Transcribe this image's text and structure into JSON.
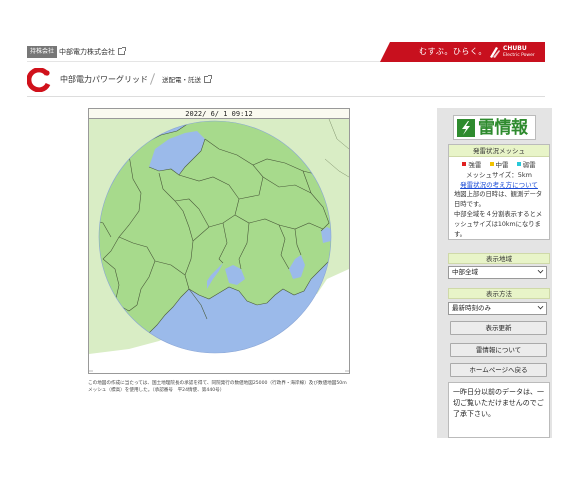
{
  "header": {
    "badge": "持株会社",
    "company": "中部電力株式会社",
    "slogan": "むすぶ。ひらく。",
    "corp_logo_name": "CHUBU",
    "corp_logo_sub": "Electric Power",
    "brand_name": "中部電力パワーグリッド",
    "breadcrumb": "送配電・託送"
  },
  "map": {
    "datetime": "2022/ 6/ 1 09:12",
    "note": "この地図の作成に当たっては、国土地理院長の承認を得て、同院発行の数値地図25000（行政界・海岸線）及び数値地図50mメッシュ（標高）を使用した。（承認番号　平24情使、第440号）",
    "colors": {
      "land": "#cfe8b8",
      "radar": "#98b8ec",
      "radar_land": "#a6d98b",
      "border": "#4a5a3a"
    }
  },
  "panel": {
    "logo_text": "雷情報",
    "status_title": "発雷状況メッシュ",
    "legend": [
      {
        "label": "強雷",
        "color": "#e02020"
      },
      {
        "label": "中雷",
        "color": "#f2c200"
      },
      {
        "label": "弱雷",
        "color": "#28c8d8"
      }
    ],
    "mesh_size": "メッシュサイズ：5km",
    "howto_link": "発雷状況の考え方について",
    "desc1": "地図上部の日時は、観測データ日時です。",
    "desc2": "中部全域を４分割表示するとメッシュサイズは10kmになります。",
    "area_title": "表示地域",
    "area_value": "中部全域",
    "method_title": "表示方法",
    "method_value": "最新時刻のみ",
    "btn_refresh": "表示更新",
    "btn_about": "雷情報について",
    "btn_home": "ホームページへ戻る",
    "notice": "一昨日分以前のデータは、一切ご覧いただけませんのでご了承下さい。"
  }
}
